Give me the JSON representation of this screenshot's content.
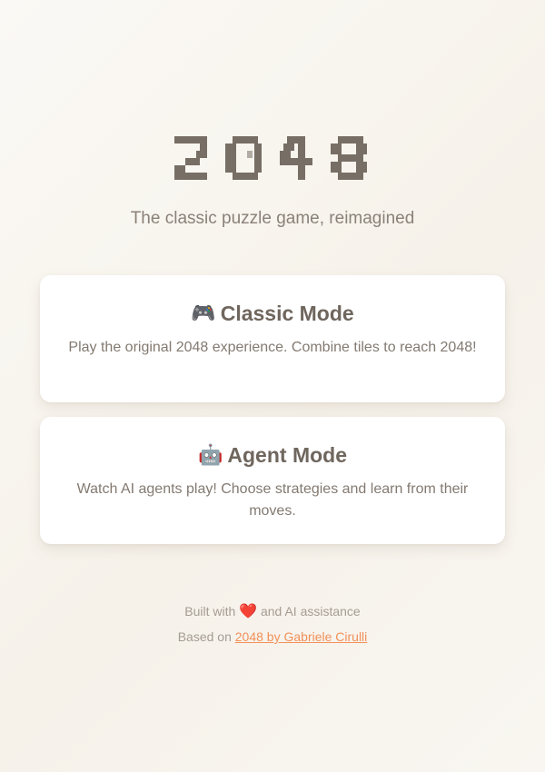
{
  "app": {
    "title": "2048",
    "tagline": "The classic puzzle game, reimagined"
  },
  "modes": [
    {
      "icon": "🎮",
      "icon_name": "gamepad-icon",
      "title": "Classic Mode",
      "description": "Play the original 2048 experience. Combine tiles to reach 2048!"
    },
    {
      "icon": "🤖",
      "icon_name": "robot-icon",
      "title": "Agent Mode",
      "description": "Watch AI agents play! Choose strategies and learn from their moves."
    }
  ],
  "footer": {
    "built_prefix": "Built with",
    "heart": "❤️",
    "built_suffix": "and AI assistance",
    "based_prefix": "Based on",
    "link_text": "2048 by Gabriele Cirulli"
  },
  "colors": {
    "logo": "#776e65",
    "link": "#f2905a",
    "card_bg": "#ffffff"
  }
}
